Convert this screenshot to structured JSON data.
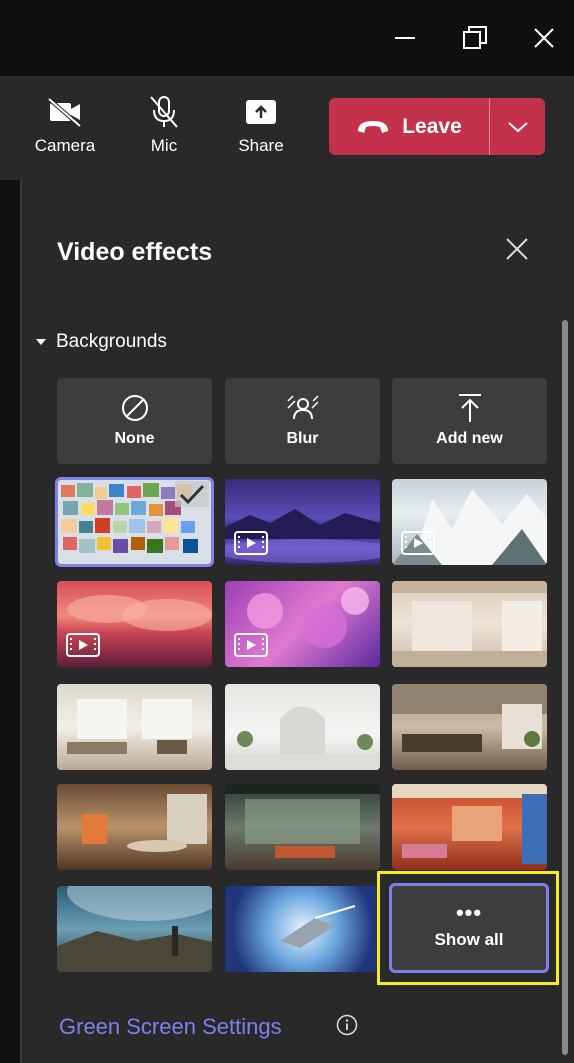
{
  "window": {
    "minimize_icon": "minimize-icon",
    "maximize_icon": "restore-icon",
    "close_icon": "close-icon"
  },
  "toolbar": {
    "camera_label": "Camera",
    "mic_label": "Mic",
    "share_label": "Share",
    "leave_label": "Leave",
    "leave_color": "#c4314b"
  },
  "panel": {
    "title": "Video effects",
    "section_label": "Backgrounds",
    "options": {
      "none": "None",
      "blur": "Blur",
      "add_new": "Add new"
    },
    "thumbnails": [
      {
        "name": "collage",
        "video": false,
        "selected": true
      },
      {
        "name": "purple-mountains",
        "video": true
      },
      {
        "name": "snowy-trees",
        "video": true
      },
      {
        "name": "pink-clouds",
        "video": true
      },
      {
        "name": "pink-flowers",
        "video": true
      },
      {
        "name": "beige-room",
        "video": false
      },
      {
        "name": "modern-living-room",
        "video": false
      },
      {
        "name": "white-arches",
        "video": false
      },
      {
        "name": "cozy-lounge",
        "video": false
      },
      {
        "name": "dining-room",
        "video": false
      },
      {
        "name": "glass-courtyard",
        "video": false
      },
      {
        "name": "orange-room",
        "video": false
      },
      {
        "name": "space-planet",
        "video": false
      },
      {
        "name": "space-ship",
        "video": false
      }
    ],
    "show_all_label": "Show all",
    "green_screen_label": "Green Screen Settings",
    "accent": "#7b83eb",
    "highlight": "#f4ec14"
  }
}
